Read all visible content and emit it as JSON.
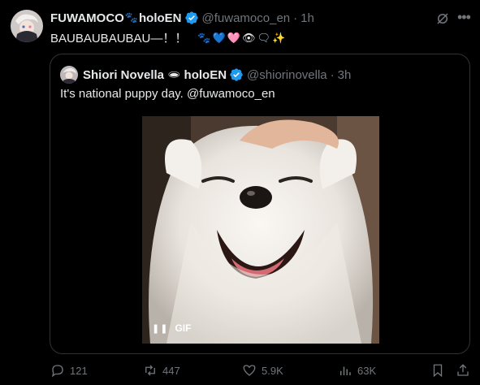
{
  "tweet": {
    "author_name": "FUWAMOCO",
    "author_emoji": "🐾",
    "author_affiliation": "holoEN",
    "handle": "@fuwamoco_en",
    "separator": "·",
    "time": "1h",
    "text": "BAUBAUBAUBAU—！！",
    "text_emojis": [
      "🐾",
      "💙",
      "🩷",
      "👁",
      "🗨",
      "✨"
    ]
  },
  "quote": {
    "author_name": "Shiori Novella",
    "author_emoji": "🕳",
    "author_affiliation": "holoEN",
    "handle": "@shiorinovella",
    "separator": "·",
    "time": "3h",
    "text": "It's national puppy day. @fuwamoco_en",
    "media_badge": "GIF"
  },
  "actions": {
    "replies": "121",
    "reposts": "447",
    "likes": "5.9K",
    "views": "63K"
  },
  "colors": {
    "background": "#000000",
    "primary_text": "#e7e9ea",
    "secondary_text": "#71767b",
    "border": "#2f3336",
    "verified": "#1d9bf0"
  },
  "icons": [
    "verified-badge-icon",
    "grok-icon",
    "more-icon",
    "reply-icon",
    "repost-icon",
    "like-icon",
    "views-icon",
    "bookmark-icon",
    "share-icon",
    "pause-icon"
  ]
}
